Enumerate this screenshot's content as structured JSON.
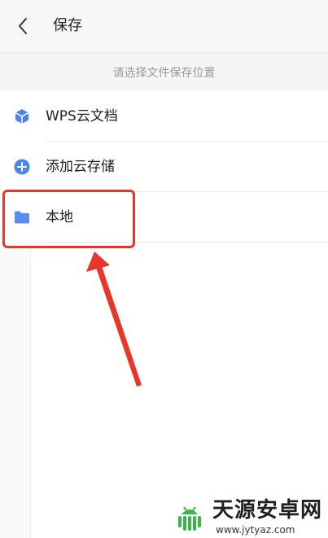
{
  "header": {
    "title": "保存",
    "back_icon": "chevron-left-icon"
  },
  "hint": {
    "text": "请选择文件保存位置"
  },
  "locations": [
    {
      "label": "WPS云文档",
      "icon": "wps-cloud-icon",
      "color": "#4a86e8"
    },
    {
      "label": "添加云存储",
      "icon": "add-circle-icon",
      "color": "#4a86e8"
    },
    {
      "label": "本地",
      "icon": "folder-icon",
      "color": "#5b8def"
    }
  ],
  "annotation": {
    "highlight_color": "#e8372a"
  },
  "watermark": {
    "title": "天源安卓网",
    "url": "www.jytyaz.com"
  }
}
